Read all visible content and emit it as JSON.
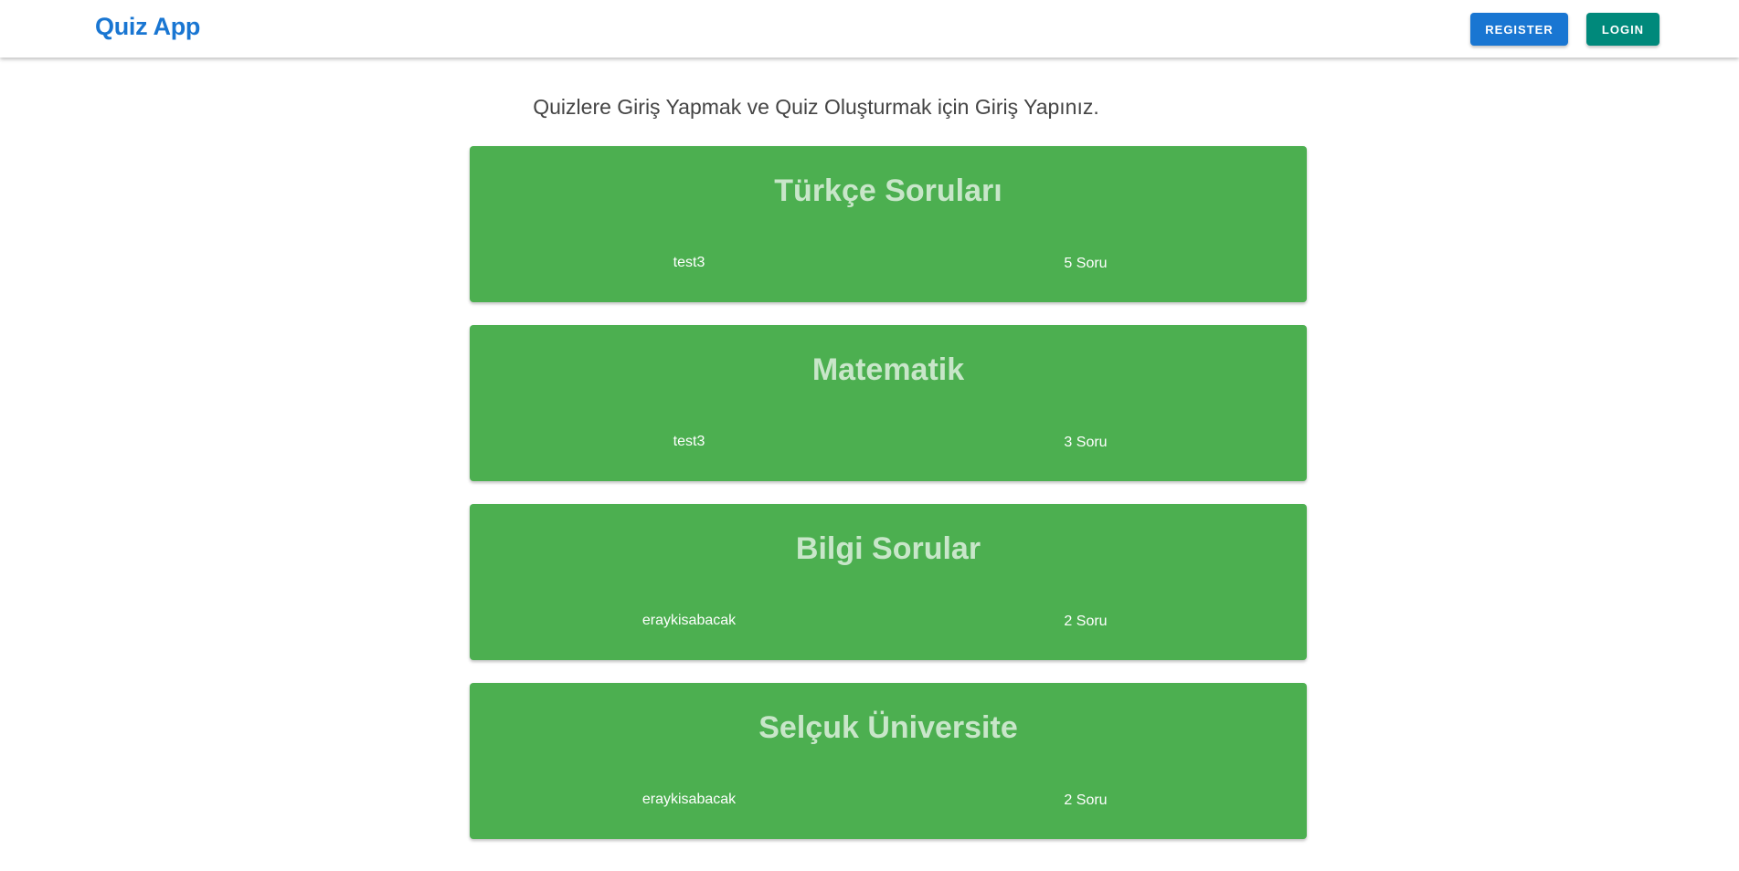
{
  "header": {
    "brand": "Quiz App",
    "register_label": "REGISTER",
    "login_label": "LOGIN"
  },
  "main": {
    "subtitle": "Quizlere Giriş Yapmak ve Quiz Oluşturmak için Giriş Yapınız.",
    "quizzes": [
      {
        "title": "Türkçe Soruları",
        "author": "test3",
        "count": "5 Soru"
      },
      {
        "title": "Matematik",
        "author": "test3",
        "count": "3 Soru"
      },
      {
        "title": "Bilgi Sorular",
        "author": "eraykisabacak",
        "count": "2 Soru"
      },
      {
        "title": "Selçuk Üniversite",
        "author": "eraykisabacak",
        "count": "2 Soru"
      }
    ]
  },
  "colors": {
    "brand": "#1976d2",
    "register": "#1976d2",
    "login": "#00897b",
    "card": "#4caf50",
    "card_title": "#c8e6c9"
  }
}
